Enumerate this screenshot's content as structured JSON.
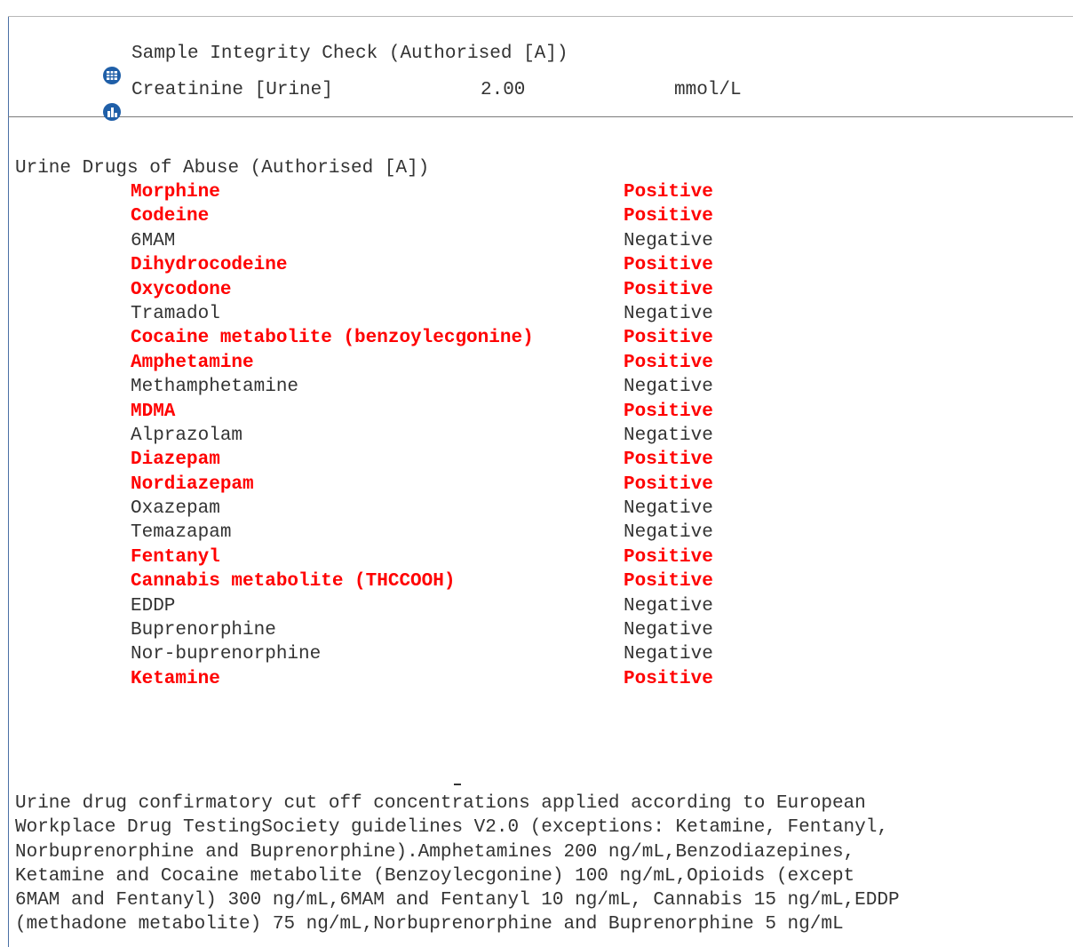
{
  "header": {
    "rows": [
      {
        "icon": "grid-globe-icon",
        "name": "Sample Integrity Check (Authorised [A])",
        "value": "",
        "unit": ""
      },
      {
        "icon": "bar-chart-icon",
        "name": "Creatinine [Urine]",
        "value": "2.00",
        "unit": "mmol/L"
      }
    ]
  },
  "panel": {
    "title": "Urine Drugs of Abuse (Authorised [A])",
    "results": [
      {
        "analyte": "Morphine",
        "result": "Positive"
      },
      {
        "analyte": "Codeine",
        "result": "Positive"
      },
      {
        "analyte": "6MAM",
        "result": "Negative"
      },
      {
        "analyte": "Dihydrocodeine",
        "result": "Positive"
      },
      {
        "analyte": "Oxycodone",
        "result": "Positive"
      },
      {
        "analyte": "Tramadol",
        "result": "Negative"
      },
      {
        "analyte": "Cocaine metabolite (benzoylecgonine)",
        "result": "Positive"
      },
      {
        "analyte": "Amphetamine",
        "result": "Positive"
      },
      {
        "analyte": "Methamphetamine",
        "result": "Negative"
      },
      {
        "analyte": "MDMA",
        "result": "Positive"
      },
      {
        "analyte": "Alprazolam",
        "result": "Negative"
      },
      {
        "analyte": "Diazepam",
        "result": "Positive"
      },
      {
        "analyte": "Nordiazepam",
        "result": "Positive"
      },
      {
        "analyte": "Oxazepam",
        "result": "Negative"
      },
      {
        "analyte": "Temazapam",
        "result": "Negative"
      },
      {
        "analyte": "Fentanyl",
        "result": "Positive"
      },
      {
        "analyte": "Cannabis metabolite (THCCOOH)",
        "result": "Positive"
      },
      {
        "analyte": "EDDP",
        "result": "Negative"
      },
      {
        "analyte": "Buprenorphine",
        "result": "Negative"
      },
      {
        "analyte": "Nor-buprenorphine",
        "result": "Negative"
      },
      {
        "analyte": "Ketamine",
        "result": "Positive"
      }
    ]
  },
  "footnote": {
    "lines": [
      "Urine drug confirmatory cut off concentrations applied according to European",
      "Workplace Drug TestingSociety guidelines V2.0 (exceptions: Ketamine, Fentanyl,",
      "Norbuprenorphine and Buprenorphine).Amphetamines 200 ng/mL,Benzodiazepines,",
      "Ketamine and Cocaine metabolite (Benzoylecgonine) 100 ng/mL,Opioids (except",
      "6MAM and Fentanyl) 300 ng/mL,6MAM and Fentanyl 10 ng/mL, Cannabis 15 ng/mL,EDDP",
      "(methadone metabolite) 75 ng/mL,Norbuprenorphine and Buprenorphine 5 ng/mL"
    ]
  },
  "colors": {
    "positive": "#ff0000",
    "negative": "#333333",
    "icon": "#1f5fa8"
  }
}
